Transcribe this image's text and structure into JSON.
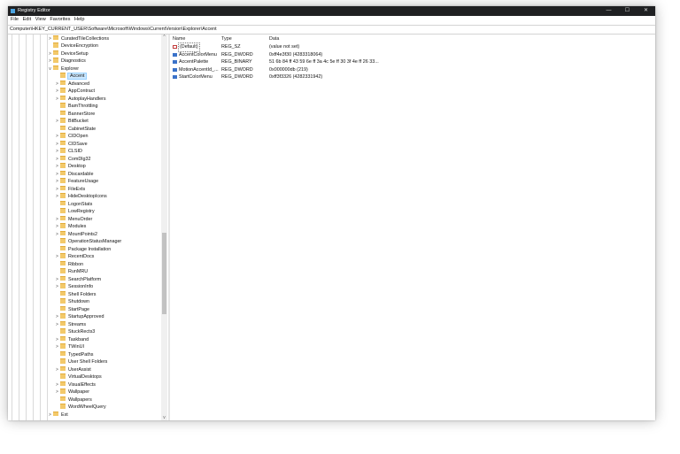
{
  "window": {
    "title": "Registry Editor",
    "buttons": {
      "minimize": "—",
      "maximize": "☐",
      "close": "✕"
    }
  },
  "menu": [
    "File",
    "Edit",
    "View",
    "Favorites",
    "Help"
  ],
  "address": "Computer\\HKEY_CURRENT_USER\\Software\\Microsoft\\Windows\\CurrentVersion\\Explorer\\Accent",
  "tree": [
    {
      "label": "CuratedTileCollections",
      "level": 0,
      "expander": ">"
    },
    {
      "label": "DeviceEncryption",
      "level": 0,
      "expander": ""
    },
    {
      "label": "DeviceSetup",
      "level": 0,
      "expander": ">"
    },
    {
      "label": "Diagnostics",
      "level": 0,
      "expander": ">"
    },
    {
      "label": "Explorer",
      "level": 0,
      "expander": "v"
    },
    {
      "label": "Accent",
      "level": 1,
      "expander": "",
      "selected": true
    },
    {
      "label": "Advanced",
      "level": 1,
      "expander": ">"
    },
    {
      "label": "AppContract",
      "level": 1,
      "expander": ">"
    },
    {
      "label": "AutoplayHandlers",
      "level": 1,
      "expander": ">"
    },
    {
      "label": "BamThrottling",
      "level": 1,
      "expander": ""
    },
    {
      "label": "BannerStore",
      "level": 1,
      "expander": ""
    },
    {
      "label": "BitBucket",
      "level": 1,
      "expander": ">"
    },
    {
      "label": "CabinetState",
      "level": 1,
      "expander": ""
    },
    {
      "label": "CIDOpen",
      "level": 1,
      "expander": ">"
    },
    {
      "label": "CIDSave",
      "level": 1,
      "expander": ">"
    },
    {
      "label": "CLSID",
      "level": 1,
      "expander": ">"
    },
    {
      "label": "ComDlg32",
      "level": 1,
      "expander": ">"
    },
    {
      "label": "Desktop",
      "level": 1,
      "expander": ">"
    },
    {
      "label": "Discardable",
      "level": 1,
      "expander": ">"
    },
    {
      "label": "FeatureUsage",
      "level": 1,
      "expander": ">"
    },
    {
      "label": "FileExts",
      "level": 1,
      "expander": ">"
    },
    {
      "label": "HideDesktopIcons",
      "level": 1,
      "expander": ">"
    },
    {
      "label": "LogonStats",
      "level": 1,
      "expander": ""
    },
    {
      "label": "LowRegistry",
      "level": 1,
      "expander": ""
    },
    {
      "label": "MenuOrder",
      "level": 1,
      "expander": ">"
    },
    {
      "label": "Modules",
      "level": 1,
      "expander": ">"
    },
    {
      "label": "MountPoints2",
      "level": 1,
      "expander": ">"
    },
    {
      "label": "OperationStatusManager",
      "level": 1,
      "expander": ""
    },
    {
      "label": "Package Installation",
      "level": 1,
      "expander": ""
    },
    {
      "label": "RecentDocs",
      "level": 1,
      "expander": ">"
    },
    {
      "label": "Ribbon",
      "level": 1,
      "expander": ""
    },
    {
      "label": "RunMRU",
      "level": 1,
      "expander": ""
    },
    {
      "label": "SearchPlatform",
      "level": 1,
      "expander": ">"
    },
    {
      "label": "SessionInfo",
      "level": 1,
      "expander": ">"
    },
    {
      "label": "Shell Folders",
      "level": 1,
      "expander": ""
    },
    {
      "label": "Shutdown",
      "level": 1,
      "expander": ""
    },
    {
      "label": "StartPage",
      "level": 1,
      "expander": ""
    },
    {
      "label": "StartupApproved",
      "level": 1,
      "expander": ">"
    },
    {
      "label": "Streams",
      "level": 1,
      "expander": ">"
    },
    {
      "label": "StuckRects3",
      "level": 1,
      "expander": ""
    },
    {
      "label": "Taskband",
      "level": 1,
      "expander": ">"
    },
    {
      "label": "TWinUI",
      "level": 1,
      "expander": ">"
    },
    {
      "label": "TypedPaths",
      "level": 1,
      "expander": ""
    },
    {
      "label": "User Shell Folders",
      "level": 1,
      "expander": ""
    },
    {
      "label": "UserAssist",
      "level": 1,
      "expander": ">"
    },
    {
      "label": "VirtualDesktops",
      "level": 1,
      "expander": ""
    },
    {
      "label": "VisualEffects",
      "level": 1,
      "expander": ">"
    },
    {
      "label": "Wallpaper",
      "level": 1,
      "expander": ">"
    },
    {
      "label": "Wallpapers",
      "level": 1,
      "expander": ""
    },
    {
      "label": "WordWheelQuery",
      "level": 1,
      "expander": ""
    },
    {
      "label": "Ext",
      "level": 0,
      "expander": ">"
    }
  ],
  "columns": {
    "name": "Name",
    "type": "Type",
    "data": "Data"
  },
  "values": [
    {
      "name": "(Default)",
      "type": "REG_SZ",
      "data": "(value not set)",
      "icon": "string-value-icon"
    },
    {
      "name": "AccentColorMenu",
      "type": "REG_DWORD",
      "data": "0xff4e3f30 (4283318064)",
      "icon": "binary-value-icon"
    },
    {
      "name": "AccentPalette",
      "type": "REG_BINARY",
      "data": "51 6b 84 ff 43 59 6e ff 3a 4c 5e ff 30 3f 4e ff 26 33...",
      "icon": "binary-value-icon"
    },
    {
      "name": "MotionAccentId_...",
      "type": "REG_DWORD",
      "data": "0x000000db (219)",
      "icon": "binary-value-icon"
    },
    {
      "name": "StartColorMenu",
      "type": "REG_DWORD",
      "data": "0xff3f3326 (4282331942)",
      "icon": "binary-value-icon"
    }
  ],
  "scrollbar": {
    "up": "^",
    "down": "v"
  }
}
